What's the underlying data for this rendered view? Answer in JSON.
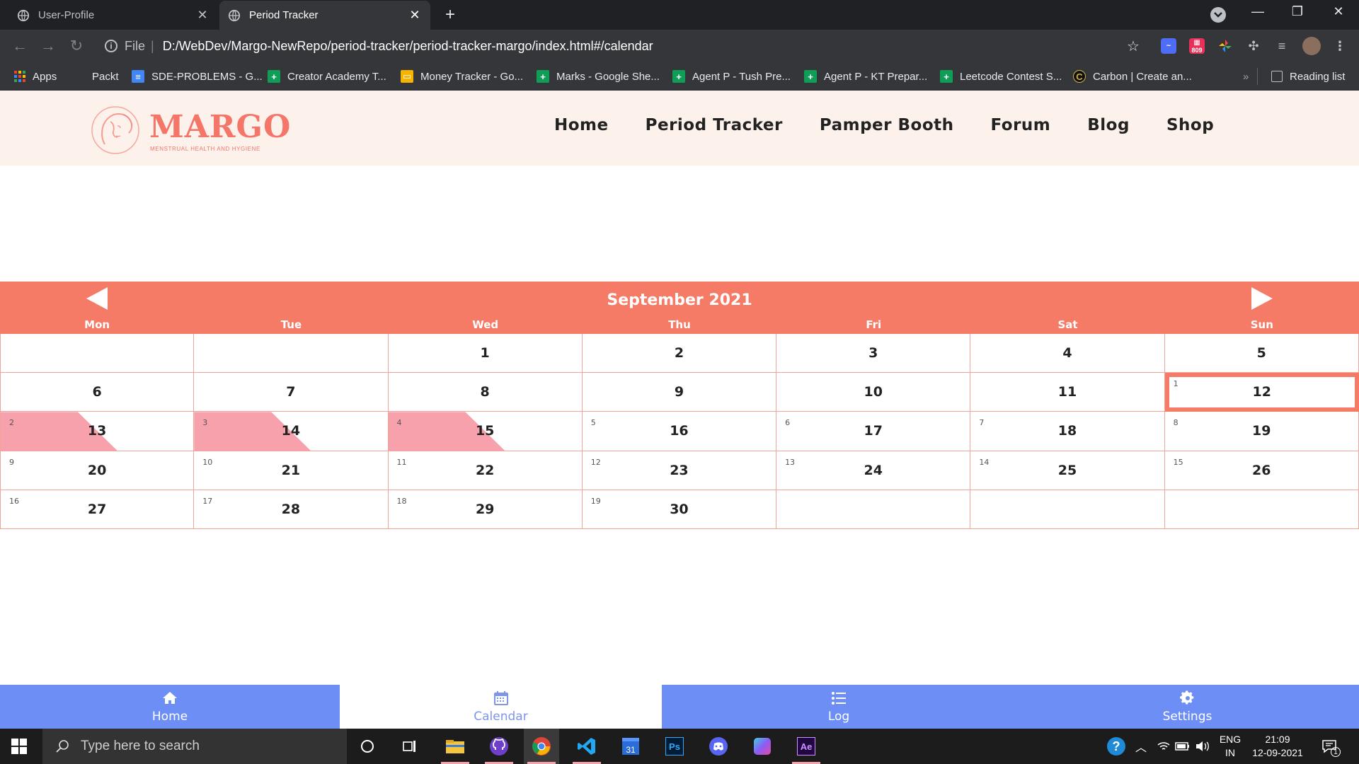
{
  "browser": {
    "tabs": [
      {
        "title": "User-Profile",
        "active": false
      },
      {
        "title": "Period Tracker",
        "active": true
      }
    ],
    "new_tab_label": "+",
    "address": {
      "scheme": "File",
      "url": "D:/WebDev/Margo-NewRepo/period-tracker/period-tracker-margo/index.html#/calendar"
    },
    "extension_badge": "809",
    "bookmarks": [
      {
        "label": "Apps",
        "icon": "apps-icon"
      },
      {
        "label": "Packt",
        "icon": "none"
      },
      {
        "label": "SDE-PROBLEMS - G...",
        "icon": "docs-icon"
      },
      {
        "label": "Creator Academy T...",
        "icon": "sheets-icon"
      },
      {
        "label": "Money Tracker - Go...",
        "icon": "slides-icon"
      },
      {
        "label": "Marks - Google She...",
        "icon": "sheets-icon"
      },
      {
        "label": "Agent P - Tush Pre...",
        "icon": "sheets-icon"
      },
      {
        "label": "Agent P - KT Prepar...",
        "icon": "sheets-icon"
      },
      {
        "label": "Leetcode Contest S...",
        "icon": "sheets-icon"
      },
      {
        "label": "Carbon | Create an...",
        "icon": "carbon-icon"
      }
    ],
    "overflow_label": "»",
    "reading_list": "Reading list"
  },
  "site": {
    "logo_text": "MARGO",
    "logo_tagline": "MENSTRUAL HEALTH AND HYGIENE",
    "nav": [
      "Home",
      "Period Tracker",
      "Pamper Booth",
      "Forum",
      "Blog",
      "Shop"
    ]
  },
  "calendar": {
    "title": "September 2021",
    "weekdays": [
      "Mon",
      "Tue",
      "Wed",
      "Thu",
      "Fri",
      "Sat",
      "Sun"
    ],
    "accent": "#f57b67",
    "period_color": "#f7a1ad",
    "weeks": [
      [
        {
          "day": ""
        },
        {
          "day": ""
        },
        {
          "day": "1"
        },
        {
          "day": "2"
        },
        {
          "day": "3"
        },
        {
          "day": "4"
        },
        {
          "day": "5"
        }
      ],
      [
        {
          "day": "6"
        },
        {
          "day": "7"
        },
        {
          "day": "8"
        },
        {
          "day": "9"
        },
        {
          "day": "10"
        },
        {
          "day": "11"
        },
        {
          "day": "12",
          "cycle": "1",
          "today": true
        }
      ],
      [
        {
          "day": "13",
          "cycle": "2",
          "period": true
        },
        {
          "day": "14",
          "cycle": "3",
          "period": true
        },
        {
          "day": "15",
          "cycle": "4",
          "period": true
        },
        {
          "day": "16",
          "cycle": "5"
        },
        {
          "day": "17",
          "cycle": "6"
        },
        {
          "day": "18",
          "cycle": "7"
        },
        {
          "day": "19",
          "cycle": "8"
        }
      ],
      [
        {
          "day": "20",
          "cycle": "9"
        },
        {
          "day": "21",
          "cycle": "10"
        },
        {
          "day": "22",
          "cycle": "11"
        },
        {
          "day": "23",
          "cycle": "12"
        },
        {
          "day": "24",
          "cycle": "13"
        },
        {
          "day": "25",
          "cycle": "14"
        },
        {
          "day": "26",
          "cycle": "15"
        }
      ],
      [
        {
          "day": "27",
          "cycle": "16"
        },
        {
          "day": "28",
          "cycle": "17"
        },
        {
          "day": "29",
          "cycle": "18"
        },
        {
          "day": "30",
          "cycle": "19"
        },
        {
          "day": ""
        },
        {
          "day": ""
        },
        {
          "day": ""
        }
      ]
    ]
  },
  "bottom_nav": [
    {
      "label": "Home",
      "icon": "home-icon",
      "active": false
    },
    {
      "label": "Calendar",
      "icon": "calendar-icon",
      "active": true
    },
    {
      "label": "Log",
      "icon": "list-icon",
      "active": false
    },
    {
      "label": "Settings",
      "icon": "gear-icon",
      "active": false
    }
  ],
  "taskbar": {
    "search_placeholder": "Type here to search",
    "lang_line1": "ENG",
    "lang_line2": "IN",
    "time": "21:09",
    "date": "12-09-2021",
    "notification_count": "1",
    "calendar_app_label": "31",
    "photoshop_label": "Ps",
    "aftereffects_label": "Ae"
  }
}
